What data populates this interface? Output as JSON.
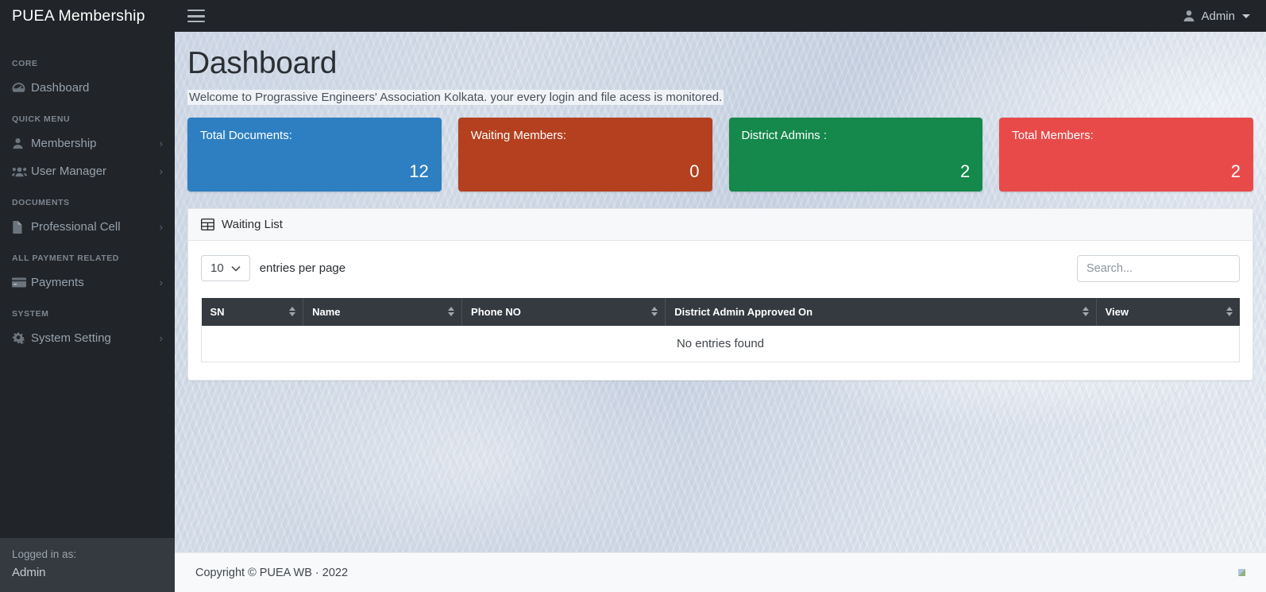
{
  "brand": {
    "title": "PUEA Membership"
  },
  "topbar": {
    "menu_toggle_icon": "hamburger-icon",
    "user_icon": "user-icon",
    "user_label": "Admin",
    "caret_icon": "caret-down-icon"
  },
  "sidebar": {
    "sections": [
      {
        "heading": "CORE",
        "items": [
          {
            "label": "Dashboard",
            "icon": "tachometer-icon",
            "has_chevron": false,
            "active": true
          }
        ]
      },
      {
        "heading": "QUICK MENU",
        "items": [
          {
            "label": "Membership",
            "icon": "user-icon",
            "has_chevron": true,
            "chevron": "›"
          },
          {
            "label": "User Manager",
            "icon": "users-icon",
            "has_chevron": true,
            "chevron": "›"
          }
        ]
      },
      {
        "heading": "DOCUMENTS",
        "items": [
          {
            "label": "Professional Cell",
            "icon": "file-icon",
            "has_chevron": true,
            "chevron": "›"
          }
        ]
      },
      {
        "heading": "ALL PAYMENT RELATED",
        "items": [
          {
            "label": "Payments",
            "icon": "credit-card-icon",
            "has_chevron": true,
            "chevron": "›"
          }
        ]
      },
      {
        "heading": "SYSTEM",
        "items": [
          {
            "label": "System Setting",
            "icon": "cogs-icon",
            "has_chevron": true,
            "chevron": "›"
          }
        ]
      }
    ],
    "footer": {
      "logged_in_label": "Logged in as:",
      "user": "Admin"
    }
  },
  "main": {
    "page_title": "Dashboard",
    "lead": "Welcome to Prograssive Engineers' Association Kolkata. your every login and file acess is monitored.",
    "stat_cards": [
      {
        "label": "Total Documents:",
        "value": "12",
        "color": "#2e7fc1"
      },
      {
        "label": "Waiting Members:",
        "value": "0",
        "color": "#b4401f"
      },
      {
        "label": "District Admins :",
        "value": "2",
        "color": "#15884b"
      },
      {
        "label": "Total Members:",
        "value": "2",
        "color": "#e84a4a"
      }
    ],
    "panel": {
      "icon": "table-icon",
      "title": "Waiting List",
      "controls": {
        "page_length_value": "10",
        "page_length_chevron": "⌄",
        "entries_label": "entries per page",
        "search_placeholder": "Search...",
        "search_value": ""
      },
      "table": {
        "columns": [
          {
            "label": "SN",
            "sortable": true,
            "width": "9.8%"
          },
          {
            "label": "Name",
            "sortable": true,
            "width": "15.3%"
          },
          {
            "label": "Phone NO",
            "sortable": true,
            "width": "19.6%"
          },
          {
            "label": "District Admin Approved On",
            "sortable": true,
            "width": "41.5%"
          },
          {
            "label": "View",
            "sortable": true,
            "width": "13.8%"
          }
        ],
        "rows": [],
        "empty_message": "No entries found"
      }
    }
  },
  "footer": {
    "copyright": "Copyright © PUEA WB · 2022"
  }
}
